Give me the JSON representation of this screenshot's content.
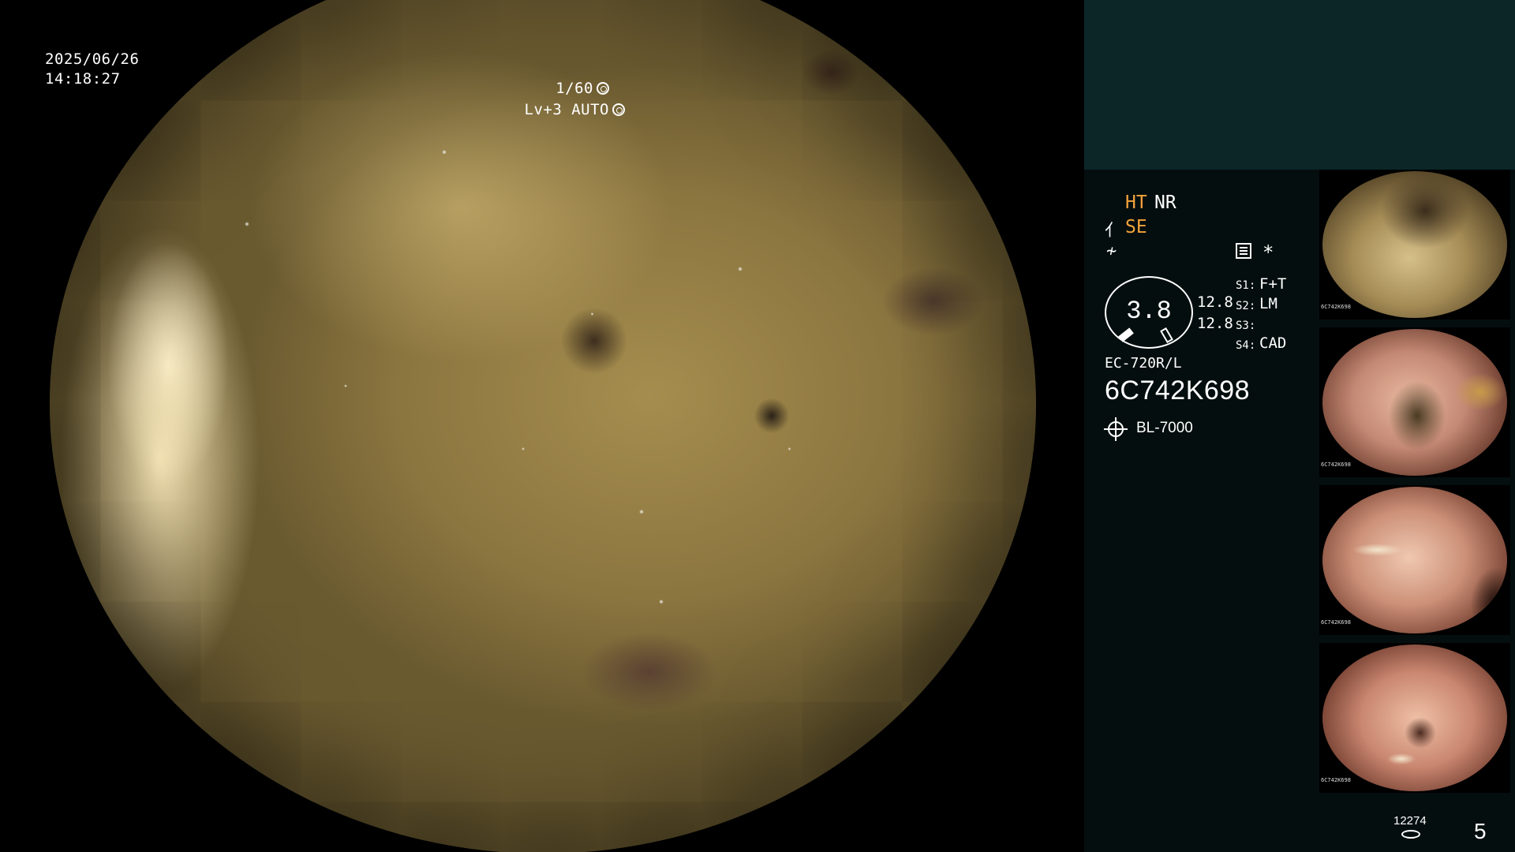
{
  "overlay": {
    "date": "2025/06/26",
    "time": "14:18:27",
    "shutter": "1/60",
    "level": "Lv+3 AUTO"
  },
  "panel": {
    "ht": "HT",
    "nr": "NR",
    "se": "SE",
    "gauge_value": "3.8",
    "value_a": "12.8",
    "value_b": "12.8",
    "switches": [
      {
        "key": "S1:",
        "value": "F+T"
      },
      {
        "key": "S2:",
        "value": "LM"
      },
      {
        "key": "S3:",
        "value": ""
      },
      {
        "key": "S4:",
        "value": "CAD"
      }
    ],
    "scope_model": "EC-720R/L",
    "scope_serial": "6C742K698",
    "light_source": "BL-7000",
    "counter": "12274",
    "page_number": "5"
  },
  "colors": {
    "accent": "#f3a33a",
    "panel_bg": "#050e0e",
    "panel_top_bg": "#0c2628"
  },
  "thumbnails": [
    {
      "stamp": "6C742K698"
    },
    {
      "stamp": "6C742K698"
    },
    {
      "stamp": "6C742K698"
    },
    {
      "stamp": "6C742K698"
    }
  ]
}
